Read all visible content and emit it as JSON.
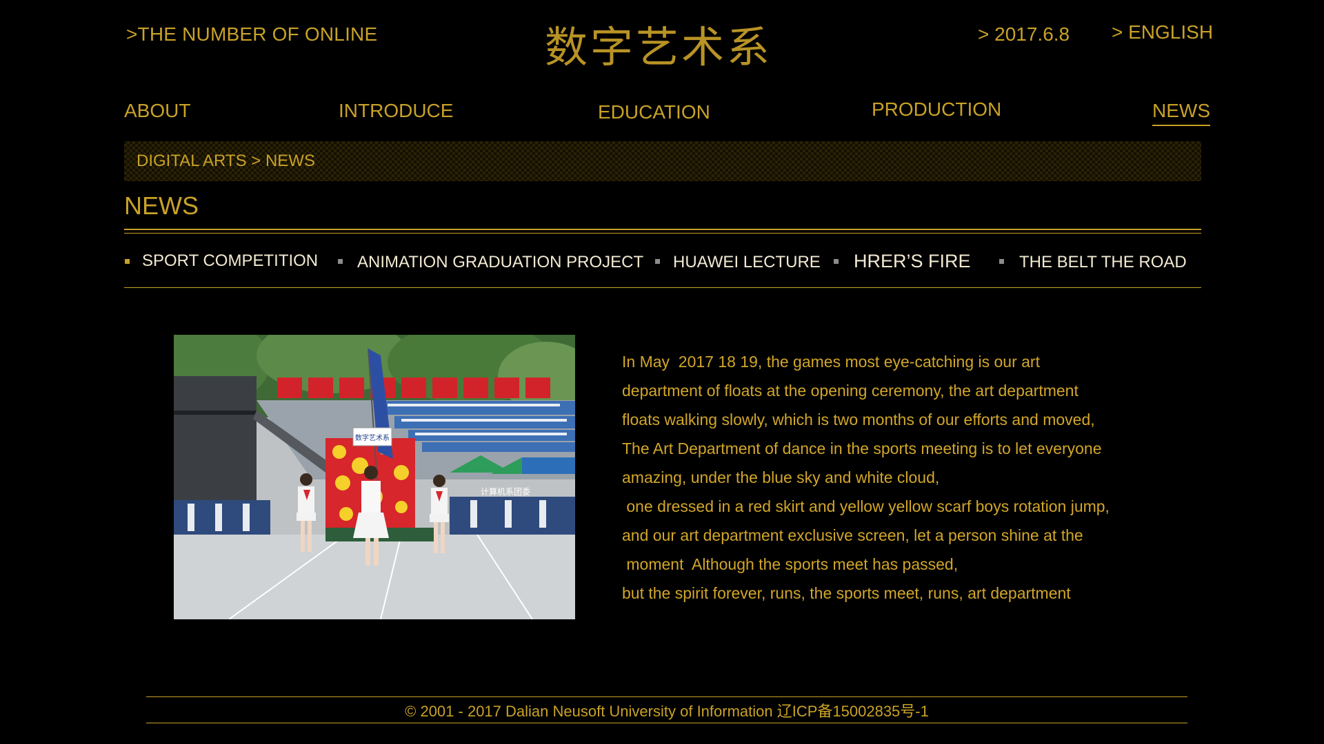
{
  "header": {
    "online_link": ">THE NUMBER OF ONLINE",
    "site_title": "数字艺术系",
    "date": ">  2017.6.8",
    "language_link": ">  ENGLISH"
  },
  "nav": {
    "about": "ABOUT",
    "introduce": "INTRODUCE",
    "education": "EDUCATION",
    "production": "PRODUCTION",
    "news": "NEWS",
    "active": "NEWS"
  },
  "breadcrumb": "DIGITAL ARTS > NEWS",
  "section_title": "NEWS",
  "subtabs": [
    {
      "label": "SPORT COMPETITION",
      "active": true
    },
    {
      "label": "ANIMATION GRADUATION PROJECT",
      "active": false
    },
    {
      "label": "HUAWEI LECTURE",
      "active": false
    },
    {
      "label": "HRER’S FIRE",
      "active": false
    },
    {
      "label": "THE BELT  THE ROAD",
      "active": false
    }
  ],
  "photo": {
    "sign_text": "数字艺术系",
    "banner_text": "计算机系团委"
  },
  "article": {
    "lines": [
      "In May  2017 18 19, the games most eye-catching is our art",
      "department of floats at the opening ceremony, the art department",
      "floats walking slowly, which is two months of our efforts and moved,",
      "The Art Department of dance in the sports meeting is to let everyone",
      "amazing, under the blue sky and white cloud,",
      " one dressed in a red skirt and yellow yellow scarf boys rotation jump,",
      "and our art department exclusive screen, let a person shine at the",
      " moment  Although the sports meet has passed,",
      "but the spirit forever, runs, the sports meet, runs, art department"
    ]
  },
  "footer": "© 2001 - 2017 Dalian Neusoft University of Information   辽ICP备15002835号-1",
  "colors": {
    "accent": "#c9a227",
    "background": "#000000",
    "tab_text": "#f2ead2"
  }
}
